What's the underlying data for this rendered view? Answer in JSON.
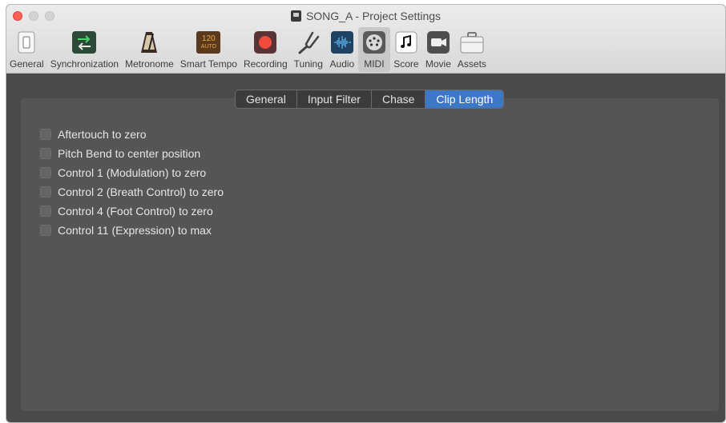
{
  "window": {
    "title": "SONG_A - Project Settings"
  },
  "toolbar": {
    "items": [
      {
        "label": "General",
        "icon": "general-switch-icon"
      },
      {
        "label": "Synchronization",
        "icon": "sync-arrows-icon"
      },
      {
        "label": "Metronome",
        "icon": "metronome-icon"
      },
      {
        "label": "Smart Tempo",
        "icon": "smart-tempo-icon",
        "badge_top": "120",
        "badge_bottom": "AUTO"
      },
      {
        "label": "Recording",
        "icon": "record-icon"
      },
      {
        "label": "Tuning",
        "icon": "tuning-fork-icon"
      },
      {
        "label": "Audio",
        "icon": "waveform-icon"
      },
      {
        "label": "MIDI",
        "icon": "midi-plug-icon",
        "active": true
      },
      {
        "label": "Score",
        "icon": "music-note-icon"
      },
      {
        "label": "Movie",
        "icon": "video-camera-icon"
      },
      {
        "label": "Assets",
        "icon": "briefcase-icon"
      }
    ]
  },
  "tabs": [
    {
      "label": "General"
    },
    {
      "label": "Input Filter"
    },
    {
      "label": "Chase"
    },
    {
      "label": "Clip Length",
      "selected": true
    }
  ],
  "options": [
    {
      "label": "Aftertouch to zero",
      "checked": false
    },
    {
      "label": "Pitch Bend to center position",
      "checked": false
    },
    {
      "label": "Control 1 (Modulation) to zero",
      "checked": false
    },
    {
      "label": "Control 2 (Breath Control) to zero",
      "checked": false
    },
    {
      "label": "Control 4 (Foot Control) to zero",
      "checked": false
    },
    {
      "label": "Control 11 (Expression) to max",
      "checked": false
    }
  ],
  "colors": {
    "accent": "#3d78c8",
    "close": "#fd5f57",
    "record": "#f24a3c"
  }
}
